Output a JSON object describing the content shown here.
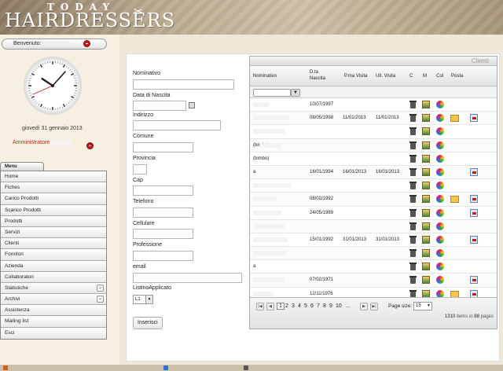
{
  "header": {
    "logo_top": "TODAY",
    "logo_main": "HAIRDRESSERS"
  },
  "user": {
    "welcome_label": "Benvenuto:",
    "role": "Amministratore",
    "date": "giovedì 31 gennaio 2013"
  },
  "clock": {
    "hour": 10,
    "minute": 7
  },
  "menu": {
    "tab_label": "Menu",
    "items": [
      {
        "label": "Home",
        "expand": false
      },
      {
        "label": "Fiches",
        "expand": false
      },
      {
        "label": "Carico Prodotti",
        "expand": false
      },
      {
        "label": "Scarico Prodotti",
        "expand": false
      },
      {
        "label": "Prodotti",
        "expand": false
      },
      {
        "label": "Servizi",
        "expand": false
      },
      {
        "label": "Clienti",
        "expand": false
      },
      {
        "label": "Fornitori",
        "expand": false
      },
      {
        "label": "Azienda",
        "expand": false
      },
      {
        "label": "Collaboratori",
        "expand": false
      },
      {
        "label": "Statistiche",
        "expand": true
      },
      {
        "label": "Archivi",
        "expand": true
      },
      {
        "label": "Assistenza",
        "expand": false
      },
      {
        "label": "Mailing list",
        "expand": false
      },
      {
        "label": "Esci",
        "expand": false
      }
    ]
  },
  "form": {
    "nominativo": "Nominativo",
    "data_nascita": "Data di Nascita",
    "indirizzo": "Indirizzo",
    "comune": "Comune",
    "provincia": "Provincia",
    "cap": "Cap",
    "telefono": "Telefono",
    "cellulare": "Cellulare",
    "professione": "Professione",
    "email": "email",
    "listino": "ListinoApplicato",
    "listino_value": "L1",
    "submit": "Inserisci"
  },
  "grid": {
    "title": "Clienti",
    "columns": [
      "Nominativo",
      "D.ta Nascita",
      "P.ma Visita",
      "Ult. Visita",
      "C",
      "M",
      "Col",
      "Posta"
    ],
    "rows": [
      {
        "name": "",
        "birth": "10/07/1997",
        "first": "",
        "last": "",
        "mail": false,
        "sms": false
      },
      {
        "name": "",
        "birth": "08/05/1998",
        "first": "11/01/2013",
        "last": "11/01/2013",
        "mail": true,
        "sms": true
      },
      {
        "name": "",
        "birth": "",
        "first": "",
        "last": "",
        "mail": false,
        "sms": false
      },
      {
        "name": "(bimbo)",
        "birth": "",
        "first": "",
        "last": "",
        "mail": false,
        "sms": false
      },
      {
        "name": "(bimbo)",
        "birth": "",
        "first": "",
        "last": "",
        "mail": false,
        "sms": false
      },
      {
        "name": "a",
        "birth": "16/01/1994",
        "first": "16/01/2013",
        "last": "16/01/2013",
        "mail": false,
        "sms": true
      },
      {
        "name": "",
        "birth": "",
        "first": "",
        "last": "",
        "mail": false,
        "sms": false
      },
      {
        "name": "",
        "birth": "08/02/1992",
        "first": "",
        "last": "",
        "mail": true,
        "sms": true
      },
      {
        "name": "",
        "birth": "24/05/1989",
        "first": "",
        "last": "",
        "mail": false,
        "sms": true
      },
      {
        "name": "",
        "birth": "",
        "first": "",
        "last": "",
        "mail": false,
        "sms": false
      },
      {
        "name": "",
        "birth": "15/01/1992",
        "first": "31/01/2013",
        "last": "31/01/2013",
        "mail": false,
        "sms": true
      },
      {
        "name": "",
        "birth": "",
        "first": "",
        "last": "",
        "mail": false,
        "sms": false
      },
      {
        "name": "a",
        "birth": "",
        "first": "",
        "last": "",
        "mail": false,
        "sms": false
      },
      {
        "name": "",
        "birth": "07/02/1971",
        "first": "",
        "last": "",
        "mail": false,
        "sms": true
      },
      {
        "name": "",
        "birth": "12/11/1976",
        "first": "",
        "last": "",
        "mail": true,
        "sms": true
      }
    ],
    "pager": {
      "pages": [
        "1",
        "2",
        "3",
        "4",
        "5",
        "6",
        "7",
        "8",
        "9",
        "10",
        "..."
      ],
      "current": "1",
      "page_size_label": "Page size:",
      "page_size": "15",
      "items_count": "1310",
      "items_label": "items in",
      "pages_count": "88",
      "pages_label": "pages"
    }
  }
}
